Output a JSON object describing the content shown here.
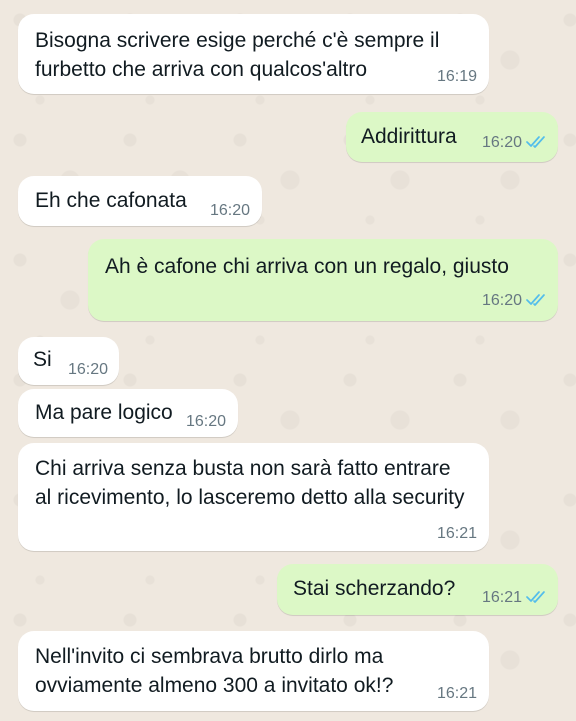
{
  "colors": {
    "incoming_bubble": "#ffffff",
    "outgoing_bubble": "#dcf8c6",
    "timestamp": "#667781",
    "read_ticks": "#53bdeb",
    "wallpaper": "#efe8df"
  },
  "messages": [
    {
      "direction": "in",
      "text": "Bisogna scrivere esige perché c'è sempre il furbetto che arriva con qualcos'altro",
      "time": "16:19"
    },
    {
      "direction": "out",
      "text": "Addirittura",
      "time": "16:20",
      "status": "read"
    },
    {
      "direction": "in",
      "text": "Eh che cafonata",
      "time": "16:20"
    },
    {
      "direction": "out",
      "text": "Ah è cafone chi arriva con un regalo, giusto",
      "time": "16:20",
      "status": "read"
    },
    {
      "direction": "in",
      "text": "Si",
      "time": "16:20"
    },
    {
      "direction": "in",
      "text": "Ma pare logico",
      "time": "16:20"
    },
    {
      "direction": "in",
      "text": "Chi arriva senza busta non sarà fatto entrare al ricevimento, lo lasceremo detto alla security",
      "time": "16:21"
    },
    {
      "direction": "out",
      "text": "Stai scherzando?",
      "time": "16:21",
      "status": "read"
    },
    {
      "direction": "in",
      "text": "Nell'invito ci sembrava brutto dirlo ma ovviamente almeno 300 a invitato ok!?",
      "time": "16:21"
    }
  ]
}
